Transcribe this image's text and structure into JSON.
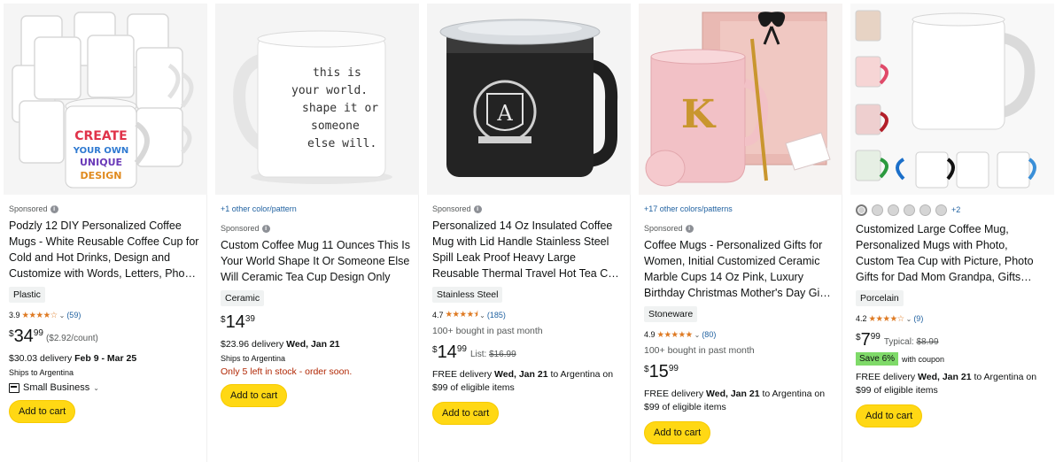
{
  "common": {
    "sponsored": "Sponsored",
    "add_to_cart": "Add to cart",
    "currency": "$"
  },
  "products": [
    {
      "title": "Podzly 12 DIY Personalized Coffee Mugs - White Reusable Coffee Cup for Cold and Hot Drinks, Design and Customize with Words, Letters, Pho…",
      "material": "Plastic",
      "rating": "3.9",
      "stars": "★★★★☆",
      "reviews": "(59)",
      "price_whole": "34",
      "price_fraction": "99",
      "price_unit": "($2.92/count)",
      "delivery_prefix": "$30.03 delivery",
      "delivery_dates": "Feb 9 - Mar 25",
      "ships": "Ships to Argentina",
      "small_business": "Small Business",
      "image_text": "CREATE YOUR OWN UNIQUE DESIGN"
    },
    {
      "color_link": "+1 other color/pattern",
      "title": "Custom Coffee Mug 11 Ounces This Is Your World Shape It Or Someone Else Will Ceramic Tea Cup Design Only",
      "material": "Ceramic",
      "price_whole": "14",
      "price_fraction": "39",
      "delivery_prefix": "$23.96 delivery",
      "delivery_dates": "Wed, Jan 21",
      "ships": "Ships to Argentina",
      "stock": "Only 5 left in stock - order soon.",
      "image_text": "this is your world. shape it or someone else will."
    },
    {
      "title": "Personalized 14 Oz Insulated Coffee Mug with Lid Handle Stainless Steel Spill Leak Proof Heavy Large Reusable Thermal Travel Hot Tea C…",
      "material": "Stainless Steel",
      "rating": "4.7",
      "stars": "★★★★⯨",
      "reviews": "(185)",
      "bought": "100+ bought in past month",
      "price_whole": "14",
      "price_fraction": "99",
      "list_label": "List:",
      "list_price": "$16.99",
      "delivery_prefix": "FREE delivery",
      "delivery_dates": "Wed, Jan 21",
      "delivery_suffix": "to Argentina on $99 of eligible items",
      "image_text": "A"
    },
    {
      "color_link": "+17 other colors/patterns",
      "title": "Coffee Mugs - Personalized Gifts for Women, Initial Customized Ceramic Marble Cups 14 Oz Pink, Luxury Birthday Christmas Mother's Day Gi…",
      "material": "Stoneware",
      "rating": "4.9",
      "stars": "★★★★★",
      "reviews": "(80)",
      "bought": "100+ bought in past month",
      "price_whole": "15",
      "price_fraction": "99",
      "delivery_prefix": "FREE delivery",
      "delivery_dates": "Wed, Jan 21",
      "delivery_suffix": "to Argentina on $99 of eligible items",
      "image_text": "K"
    },
    {
      "swatches_more": "+2",
      "title": "Customized Large Coffee Mug, Personalized Mugs with Photo, Custom Tea Cup with Picture, Photo Gifts for Dad Mom Grandpa, Gifts…",
      "material": "Porcelain",
      "rating": "4.2",
      "stars": "★★★★☆",
      "reviews": "(9)",
      "price_whole": "7",
      "price_fraction": "99",
      "typical_label": "Typical:",
      "typical_price": "$8.99",
      "coupon_badge": "Save 6%",
      "coupon_text": "with coupon",
      "delivery_prefix": "FREE delivery",
      "delivery_dates": "Wed, Jan 21",
      "delivery_suffix": "to Argentina on $99 of eligible items"
    }
  ]
}
